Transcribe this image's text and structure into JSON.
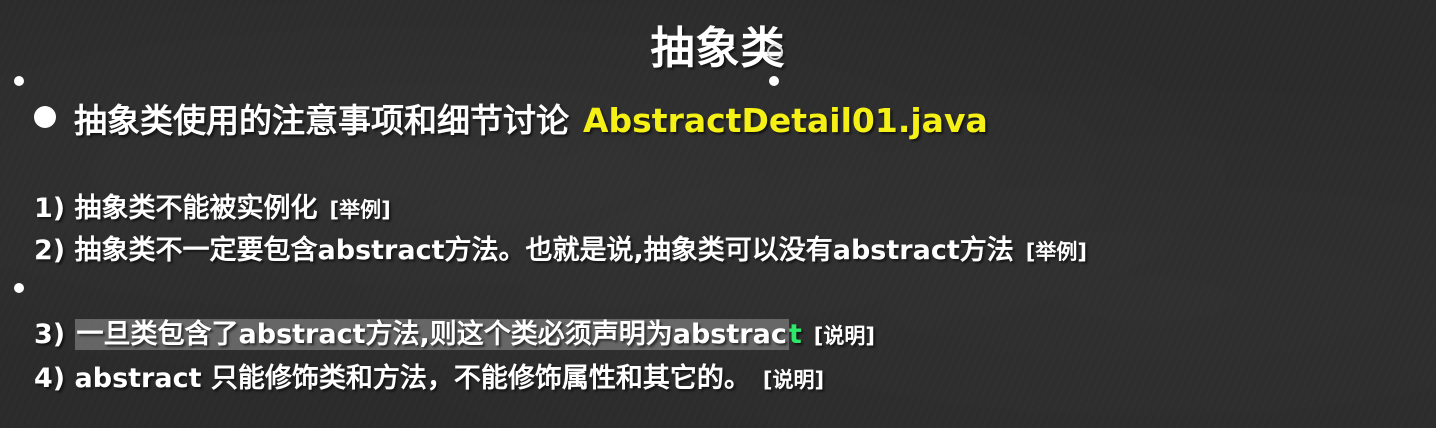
{
  "slide": {
    "title": "抽象类",
    "bullet": {
      "text": "抽象类使用的注意事项和细节讨论",
      "filename": "AbstractDetail01.java"
    },
    "items": [
      {
        "text": "1) 抽象类不能被实例化",
        "tag": "[举例]"
      },
      {
        "text": "2) 抽象类不一定要包含abstract方法。也就是说,抽象类可以没有abstract方法",
        "tag": "[举例]"
      },
      {
        "number": "3) ",
        "highlighted_text": "一旦类包含了abstract方法,则这个类必须声明为abstrac",
        "last_letter": "t",
        "tag": "[说明]"
      },
      {
        "text": "4) abstract 只能修饰类和方法，不能修饰属性和其它的。",
        "tag": "[说明]"
      }
    ]
  },
  "colors": {
    "background": "#2b2b2b",
    "text": "#ffffff",
    "filename": "#f5f015",
    "highlight": "#969696",
    "caret_letter": "#2ee86a"
  }
}
